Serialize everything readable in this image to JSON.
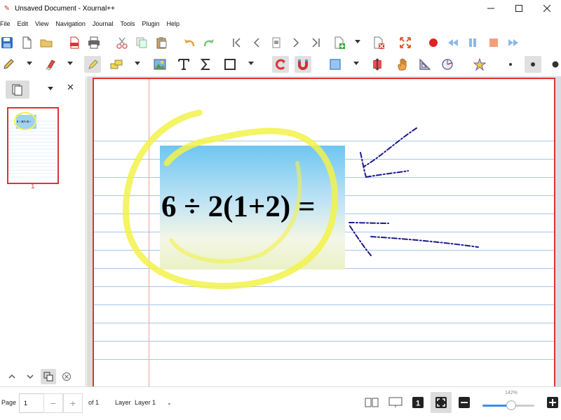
{
  "window": {
    "title": "Unsaved Document - Xournal++",
    "controls": [
      "minimize",
      "maximize",
      "close"
    ]
  },
  "menu": [
    "File",
    "Edit",
    "View",
    "Navigation",
    "Journal",
    "Tools",
    "Plugin",
    "Help"
  ],
  "sidebar": {
    "page_thumbnail_number": "1",
    "thumbnail_text": "6 ÷ 2(1+2) ="
  },
  "document": {
    "equation": "6 ÷ 2(1+2) ="
  },
  "statusbar": {
    "page_label": "Page",
    "page_value": "1",
    "of_label": "of 1",
    "layer_label": "Layer",
    "layer_value": "Layer 1",
    "zoom_label": "142%",
    "zoom_fraction": 0.55
  },
  "colors": {
    "accent_red": "#dd3333",
    "toolbar_blue": "#4a90d9",
    "highlighter": "#f2f24a",
    "pen": "#1a1a8c",
    "rule_line": "#a6c7ec"
  }
}
